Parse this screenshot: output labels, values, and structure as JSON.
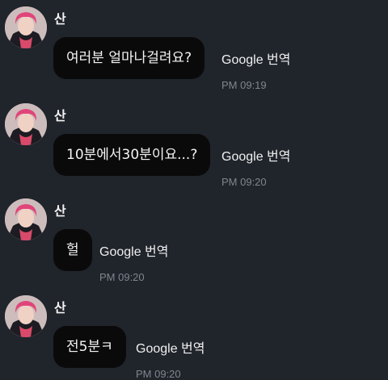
{
  "messages": [
    {
      "sender": "산",
      "text": "여러분 얼마나걸려요?",
      "translate_label": "Google 번역",
      "time": "PM 09:19"
    },
    {
      "sender": "산",
      "text": "10분에서30분이요...?",
      "translate_label": "Google 번역",
      "time": "PM 09:20"
    },
    {
      "sender": "산",
      "text": "헐",
      "translate_label": "Google 번역",
      "time": "PM 09:20"
    },
    {
      "sender": "산",
      "text": "전5분ㅋ",
      "translate_label": "Google 번역",
      "time": "PM 09:20"
    }
  ]
}
